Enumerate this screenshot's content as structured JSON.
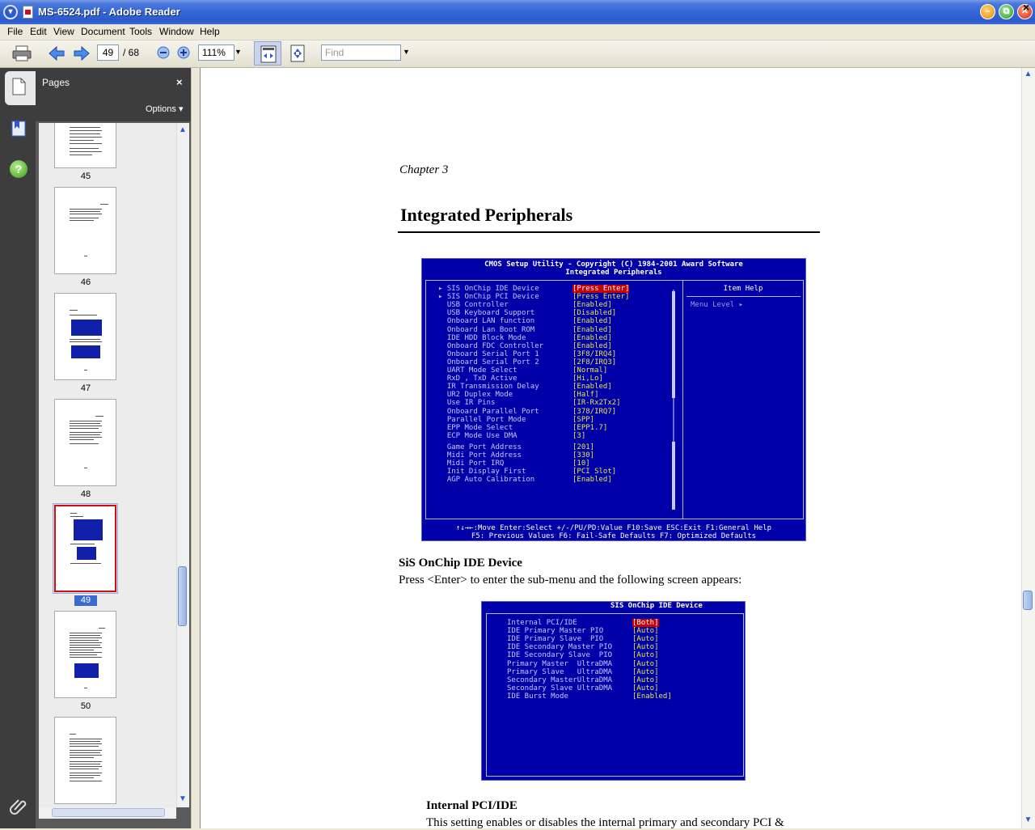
{
  "window": {
    "title": "MS-6524.pdf - Adobe Reader",
    "minimize": "–",
    "maximize": "⧉",
    "close": "✕"
  },
  "menu": {
    "items": [
      "File",
      "Edit",
      "View",
      "Document",
      "Tools",
      "Window",
      "Help"
    ],
    "close": "×"
  },
  "toolbar": {
    "current_page": "49",
    "page_total": "/ 68",
    "zoom": "111%",
    "find_placeholder": "Find"
  },
  "pages_panel": {
    "title": "Pages",
    "close": "×",
    "options": "Options ▾",
    "thumbnails": [
      {
        "label": "45"
      },
      {
        "label": "46"
      },
      {
        "label": "47"
      },
      {
        "label": "48"
      },
      {
        "label": "49",
        "selected": true
      },
      {
        "label": "50"
      }
    ]
  },
  "document": {
    "chapter": "Chapter 3",
    "title": "Integrated Peripherals",
    "bios_main": {
      "header1": "CMOS Setup Utility - Copyright (C) 1984-2001 Award Software",
      "header2": "Integrated Peripherals",
      "help_title": "Item Help",
      "menu_level": "Menu Level   ▸",
      "rows": [
        {
          "label": "▸ SIS OnChip IDE Device",
          "value": "[Press Enter]",
          "highlight": true
        },
        {
          "label": "▸ SIS OnChip PCI Device",
          "value": "[Press Enter]"
        },
        {
          "label": "  USB Controller",
          "value": "[Enabled]"
        },
        {
          "label": "  USB Keyboard Support",
          "value": "[Disabled]"
        },
        {
          "label": "  Onboard LAN function",
          "value": "[Enabled]"
        },
        {
          "label": "  Onboard Lan Boot ROM",
          "value": "[Enabled]"
        },
        {
          "label": "  IDE HDD Block Mode",
          "value": "[Enabled]"
        },
        {
          "label": "  Onboard FDC Controller",
          "value": "[Enabled]"
        },
        {
          "label": "  Onboard Serial Port 1",
          "value": "[3F8/IRQ4]"
        },
        {
          "label": "  Onboard Serial Port 2",
          "value": "[2F8/IRQ3]"
        },
        {
          "label": "  UART Mode Select",
          "value": "[Normal]"
        },
        {
          "label": "  RxD , TxD Active",
          "value": "[Hi,Lo]"
        },
        {
          "label": "  IR Transmission Delay",
          "value": "[Enabled]"
        },
        {
          "label": "  UR2 Duplex Mode",
          "value": "[Half]"
        },
        {
          "label": "  Use IR Pins",
          "value": "[IR-Rx2Tx2]"
        },
        {
          "label": "  Onboard Parallel Port",
          "value": "[378/IRQ7]"
        },
        {
          "label": "  Parallel Port Mode",
          "value": "[SPP]"
        },
        {
          "label": "  EPP Mode Select",
          "value": "[EPP1.7]"
        },
        {
          "label": "  ECP Mode Use DMA",
          "value": "[3]"
        },
        {
          "label": "  Game Port Address",
          "value": "[201]"
        },
        {
          "label": "  Midi Port Address",
          "value": "[330]"
        },
        {
          "label": "  Midi Port IRQ",
          "value": "[10]"
        },
        {
          "label": "  Init Display First",
          "value": "[PCI Slot]"
        },
        {
          "label": "  AGP Auto Calibration",
          "value": "[Enabled]"
        }
      ],
      "footer1": "↑↓→←:Move  Enter:Select  +/-/PU/PD:Value  F10:Save  ESC:Exit  F1:General Help",
      "footer2": "F5: Previous Values    F6: Fail-Safe Defaults    F7: Optimized Defaults"
    },
    "sub_heading": "SiS OnChip IDE Device",
    "sub_text": "Press <Enter> to enter the sub-menu and the following screen appears:",
    "bios_sub": {
      "title": "SIS OnChip IDE Device",
      "rows": [
        {
          "label": "Internal PCI/IDE",
          "value": "[Both]",
          "highlight": true
        },
        {
          "label": "IDE Primary Master PIO",
          "value": "[Auto]"
        },
        {
          "label": "IDE Primary Slave  PIO",
          "value": "[Auto]"
        },
        {
          "label": "IDE Secondary Master PIO",
          "value": "[Auto]"
        },
        {
          "label": "IDE Secondary Slave  PIO",
          "value": "[Auto]"
        },
        {
          "label": "Primary Master  UltraDMA",
          "value": "[Auto]"
        },
        {
          "label": "Primary Slave   UltraDMA",
          "value": "[Auto]"
        },
        {
          "label": "Secondary MasterUltraDMA",
          "value": "[Auto]"
        },
        {
          "label": "Secondary Slave UltraDMA",
          "value": "[Auto]"
        },
        {
          "label": "IDE Burst Mode",
          "value": "[Enabled]"
        }
      ]
    },
    "item_heading": "Internal PCI/IDE",
    "item_text": "This setting enables or disables the internal primary and secondary PCI &"
  },
  "colors": {
    "bios_bg": "#0000a8",
    "bios_value": "#e8e840",
    "bios_highlight": "#c80000",
    "title_bar": "#3566d6"
  }
}
